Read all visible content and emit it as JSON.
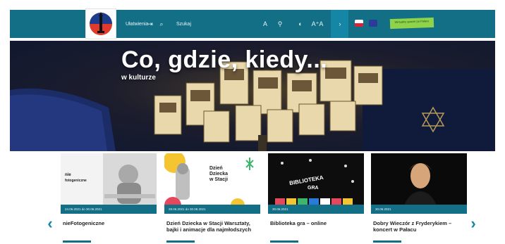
{
  "header": {
    "logo_icon": "museum-tower-logo",
    "links": [
      {
        "label": "Ułatwienia",
        "icon": "exit-icon"
      },
      {
        "label": "Szukaj",
        "icon": "search-icon"
      }
    ],
    "tools": {
      "tool_1": "A",
      "tool_2": "⚲",
      "contrast_icon": "◐",
      "font_size": "A⁺A"
    },
    "accent_box_icon": "chevron-icon",
    "cta_text": "Wirtualny spacer po Pałacu",
    "colors": {
      "bar": "#136f86",
      "accent": "#1686a6",
      "cta": "#8fd34a"
    }
  },
  "hero": {
    "title": "Co, gdzie, kiedy...",
    "subtitle": "w kulturze"
  },
  "carousel": {
    "prev_icon": "chevron-left-icon",
    "next_icon": "chevron-right-icon",
    "cards": [
      {
        "date": "24.06.2021 do 30.06.2021",
        "title": "nieFotogeniczne",
        "image_text_1": "nie",
        "image_text_2": "fotogeniczne"
      },
      {
        "date": "28.06.2021 do 30.08.2021",
        "title": "Dzień Dziecka w Stacji Warsztaty, bajki i animacje dla najmłodszych",
        "image_text_1": "Dzień",
        "image_text_2": "Dziecka",
        "image_text_3": "w Stacji"
      },
      {
        "date": "30.06.2021",
        "title": "Biblioteka gra – online",
        "image_text_1": "BIBLIOTEKA",
        "image_text_2": "GRA"
      },
      {
        "date": "30.06.2021",
        "title": "Dobry Wieczór z Fryderykiem – koncert w Pałacu",
        "image_text_1": ""
      }
    ]
  }
}
